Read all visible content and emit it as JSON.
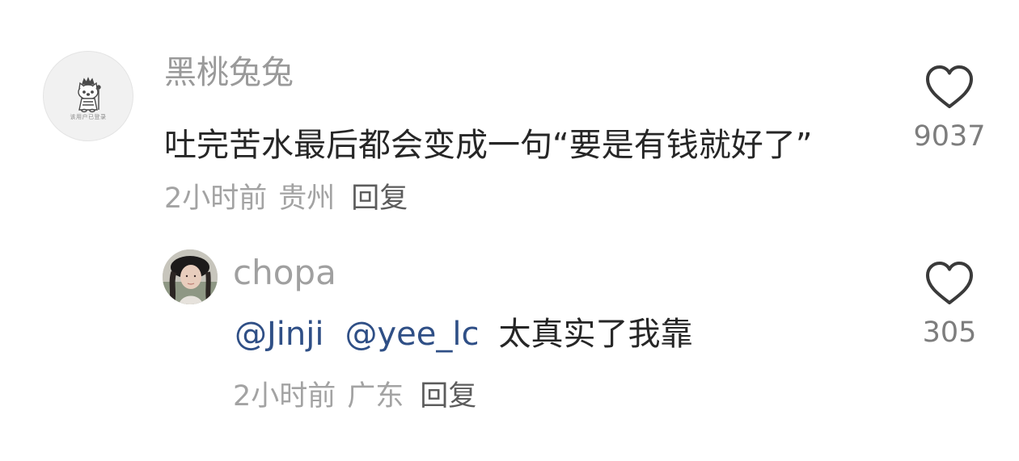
{
  "comments": [
    {
      "username": "黑桃兔兔",
      "avatar_caption": "该用户已登录",
      "text": "吐完苦水最后都会变成一句“要是有钱就好了”",
      "time": "2小时前",
      "location": "贵州",
      "reply_label": "回复",
      "likes": "9037"
    },
    {
      "username": "chopa",
      "mention_1": "@Jinji",
      "mention_2": "@yee_lc",
      "text": "太真实了我靠",
      "time": "2小时前",
      "location": "广东",
      "reply_label": "回复",
      "likes": "305"
    }
  ],
  "icons": {
    "like": "heart-outline-icon"
  },
  "colors": {
    "mention": "#2f4f86",
    "username": "#9a9a9a",
    "body_text": "#262626",
    "meta_text": "#a3a3a3"
  }
}
